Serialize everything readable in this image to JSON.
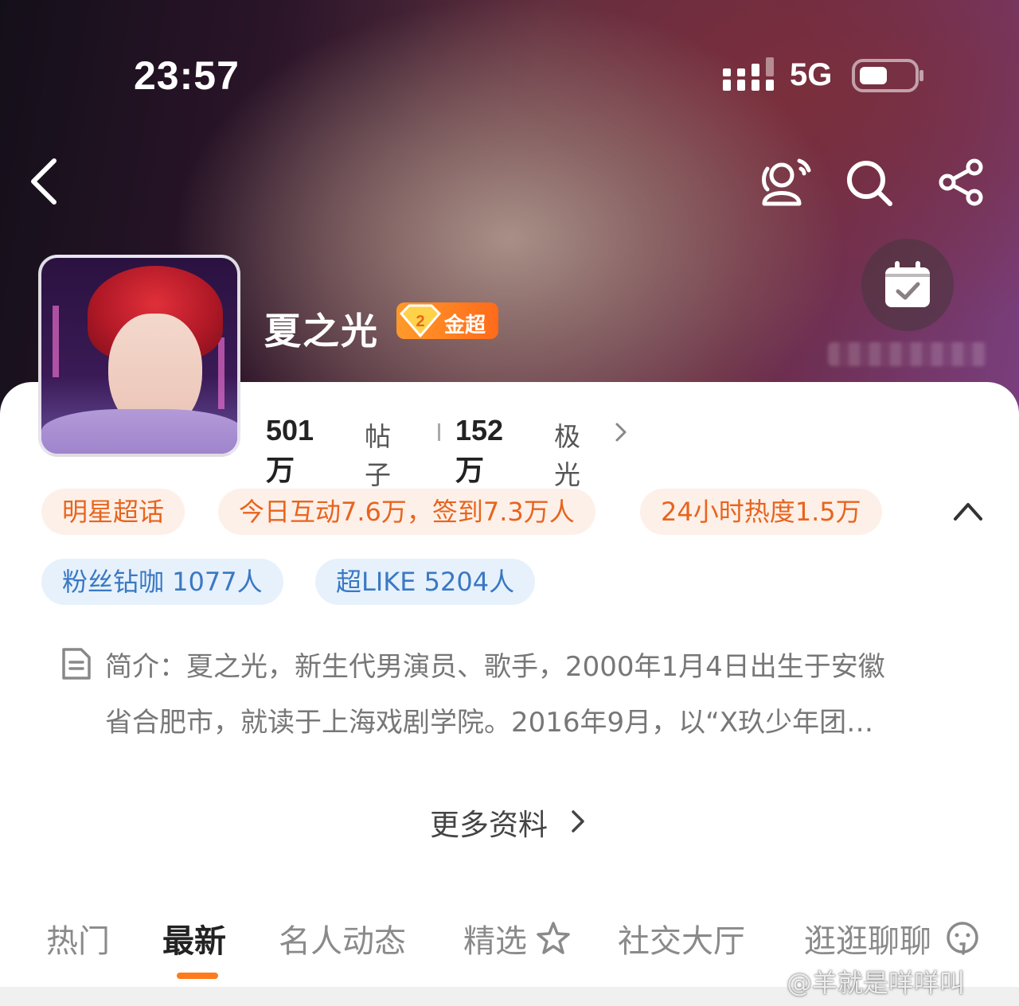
{
  "status_bar": {
    "time": "23:57",
    "network": "5G"
  },
  "colors": {
    "accent_orange": "#ff7a1a",
    "tag_orange_bg": "#fdf0e8",
    "tag_orange_text": "#e8641e",
    "tag_blue_bg": "#e6f1fb",
    "tag_blue_text": "#3a78c4"
  },
  "header": {
    "back_icon": "chevron-left-icon",
    "actions": [
      "friend-icon",
      "search-icon",
      "share-icon"
    ],
    "checkin_icon": "calendar-check-icon"
  },
  "profile": {
    "name": "夏之光",
    "badge_level": "2",
    "badge_label": "金超",
    "posts_count": "501万",
    "posts_label": "帖子",
    "aurora_count": "152万",
    "aurora_label": "极光"
  },
  "tags": {
    "row1": [
      "明星超话",
      "今日互动7.6万，签到7.3万人",
      "24小时热度1.5万"
    ],
    "row2": [
      "粉丝钻咖 1077人",
      "超LIKE 5204人"
    ]
  },
  "intro": {
    "line1": "简介：夏之光，新生代男演员、歌手，2000年1月4日出生于安徽",
    "line2": "省合肥市，就读于上海戏剧学院。2016年9月，以“X玖少年团…"
  },
  "more_info_label": "更多资料",
  "tabs": [
    "热门",
    "最新",
    "名人动态",
    "精选",
    "社交大厅",
    "逛逛聊聊"
  ],
  "active_tab": "最新",
  "watermark": "@羊就是咩咩叫"
}
